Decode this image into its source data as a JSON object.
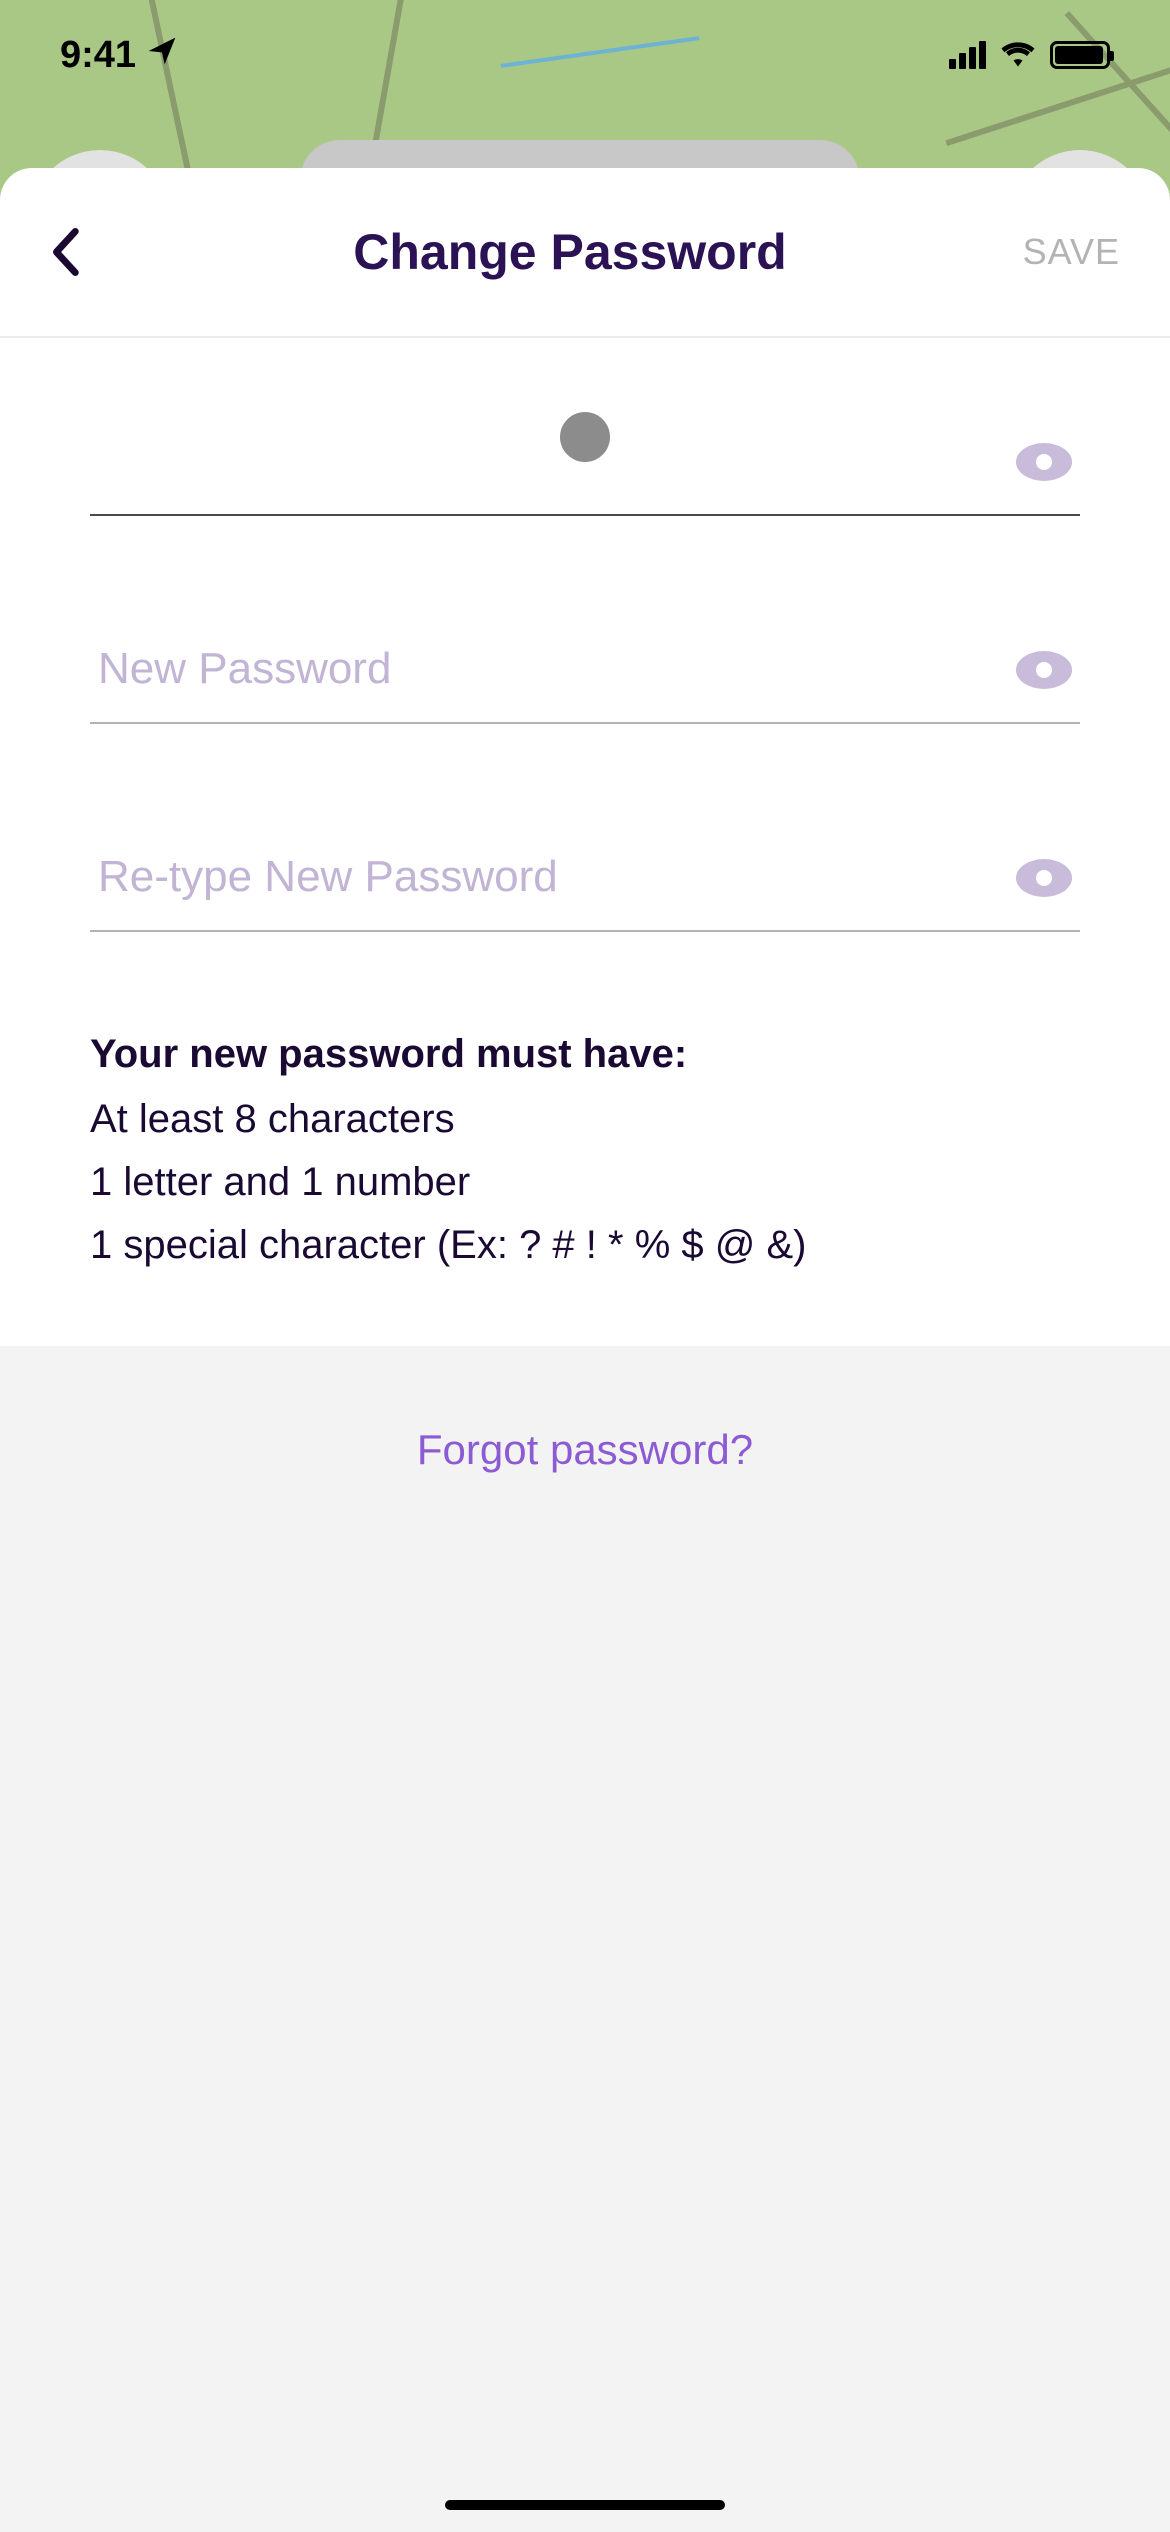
{
  "status_bar": {
    "time": "9:41"
  },
  "header": {
    "title": "Change Password",
    "save_label": "SAVE"
  },
  "fields": {
    "current": {
      "placeholder": ""
    },
    "new": {
      "placeholder": "New Password"
    },
    "retype": {
      "placeholder": "Re-type New Password"
    }
  },
  "requirements": {
    "title": "Your new password must have:",
    "items": [
      "At least 8 characters",
      "1 letter and 1 number",
      "1 special character (Ex: ? # ! * % $ @ &)"
    ]
  },
  "footer": {
    "forgot_label": "Forgot password?"
  }
}
